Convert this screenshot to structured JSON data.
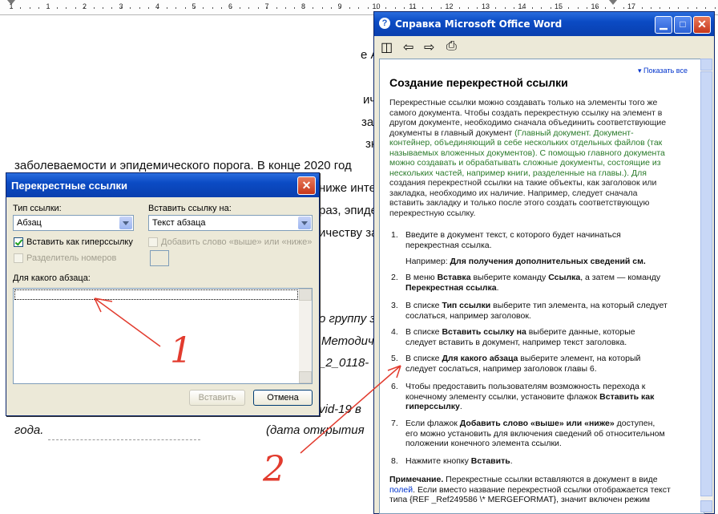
{
  "ruler": {
    "numbers": [
      "1",
      "1",
      "2",
      "3",
      "4",
      "5",
      "6",
      "7",
      "8",
      "9",
      "10",
      "11",
      "12",
      "13",
      "14",
      "15",
      "16",
      "17"
    ]
  },
  "document": {
    "line1": "заболеваемости и эпидемического порога.  В конце 2020 год",
    "frag_a": "ичес",
    "frag_b": "зап",
    "frag_c": "зн",
    "frag_d": "е А",
    "frag_e": "ниже инте",
    "frag_f": "раз, эпиде",
    "frag_g": "ичеству за",
    "frag_h": "о группу з",
    "frag_i": "Методич",
    "frag_j": "_2_0118-",
    "frag_k": "vid-19 в",
    "frag_l": "года.",
    "frag_m": "(дата открытия"
  },
  "dialog": {
    "title": "Перекрестные ссылки",
    "ref_type_label": "Тип ссылки:",
    "ref_type_value": "Абзац",
    "insert_ref_label": "Вставить ссылку на:",
    "insert_ref_value": "Текст абзаца",
    "hyperlink_label": "Вставить как гиперссылку",
    "hyperlink_checked": true,
    "above_below_label": "Добавить слово «выше» или «ниже»",
    "separator_label": "Разделитель номеров",
    "for_which_label": "Для какого абзаца:",
    "insert_button": "Вставить",
    "cancel_button": "Отмена"
  },
  "help": {
    "title": "Справка Microsoft Office Word",
    "show_all": "Показать все",
    "heading": "Создание перекрестной ссылки",
    "intro": [
      {
        "t": "Перекрестные ссылки можно создавать только на элементы того же",
        "g": ""
      },
      {
        "t": "самого документа. Чтобы создать перекрестную ссылку на элемент в",
        "g": ""
      },
      {
        "t": "другом документе, необходимо сначала объединить соответствующие",
        "g": ""
      },
      {
        "t": "документы в главный документ ",
        "g": "(Главный документ. Документ-"
      },
      {
        "t": "",
        "g": "контейнер, объединяющий в себе нескольких отдельных файлов (так"
      },
      {
        "t": "",
        "g": "называемых вложенных документов). С помощью главного документа"
      },
      {
        "t": "",
        "g": "можно создавать и обрабатывать сложные документы, состоящие из"
      },
      {
        "t": "",
        "g": "нескольких частей, например книги, разделенные на главы.). Для"
      },
      {
        "t": "создания перекрестной ссылки на такие объекты, как заголовок или",
        "g": ""
      },
      {
        "t": "закладка, необходимо их наличие. Например, следует сначала",
        "g": ""
      },
      {
        "t": "вставить закладку и только после этого создать соответствующую",
        "g": ""
      },
      {
        "t": "перекрестную ссылку.",
        "g": ""
      }
    ],
    "steps": {
      "s1_num": "1.",
      "s1_l1": "Введите в документ текст, с которого будет начинаться",
      "s1_l2": "перекрестная ссылка.",
      "s1_ex_a": "Например: ",
      "s1_ex_b": "Для получения дополнительных сведений см.",
      "s2_num": "2.",
      "s2_a": "В меню ",
      "s2_b": "Вставка",
      "s2_c": " выберите команду ",
      "s2_d": "Ссылка",
      "s2_e": ", а затем — команду",
      "s2_f": "Перекрестная ссылка",
      "s2_g": ".",
      "s3_num": "3.",
      "s3_a": "В списке ",
      "s3_b": "Тип ссылки",
      "s3_c": " выберите тип элемента, на который следует",
      "s3_d": "сослаться, например заголовок.",
      "s4_num": "4.",
      "s4_a": "В списке ",
      "s4_b": "Вставить ссылку на",
      "s4_c": " выберите данные, которые",
      "s4_d": "следует вставить в документ, например текст заголовка.",
      "s5_num": "5.",
      "s5_a": "В списке ",
      "s5_b": "Для какого абзаца",
      "s5_c": " выберите элемент, на который",
      "s5_d": "следует сослаться, например заголовок главы 6.",
      "s6_num": "6.",
      "s6_a": "Чтобы предоставить пользователям возможность перехода к",
      "s6_b": "конечному элементу ссылки, установите флажок ",
      "s6_c": "Вставить как",
      "s6_d": "гиперссылку",
      "s6_e": ".",
      "s7_num": "7.",
      "s7_a": "Если флажок ",
      "s7_b": "Добавить слово «выше» или «ниже»",
      "s7_c": " доступен,",
      "s7_d": "его можно установить для включения сведений об относительном",
      "s7_e": "положении конечного элемента ссылки.",
      "s8_num": "8.",
      "s8_a": "Нажмите кнопку ",
      "s8_b": "Вставить",
      "s8_c": "."
    },
    "note_label": "Примечание.",
    "note_l1": " Перекрестные ссылки вставляются в документ в виде",
    "note_l2_link": "полей",
    "note_l2": ". Если вместо название перекрестной ссылки отображается текст",
    "note_l3": "типа {REF _Ref249586 \\* MERGEFORMAT}, значит включен режим"
  },
  "annotations": {
    "mark1": "1",
    "mark2": "2"
  }
}
